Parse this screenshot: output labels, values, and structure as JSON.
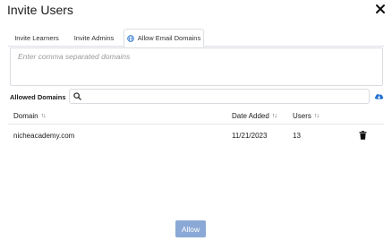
{
  "dialog": {
    "title": "Invite Users"
  },
  "tabs": [
    {
      "label": "Invite Learners"
    },
    {
      "label": "Invite Admins"
    },
    {
      "label": "Allow Email Domains"
    }
  ],
  "domain_input": {
    "placeholder": "Enter comma separated domains",
    "value": ""
  },
  "allowed": {
    "label": "Allowed Domains",
    "search_value": ""
  },
  "table": {
    "columns": [
      {
        "label": "Domain",
        "sort_icon": "↑↓"
      },
      {
        "label": "Date Added",
        "sort_icon": "↑↓"
      },
      {
        "label": "Users",
        "sort_icon": "↑↓"
      }
    ],
    "rows": [
      {
        "domain": "nicheacademy.com",
        "date_added": "11/21/2023",
        "users": "13"
      }
    ]
  },
  "actions": {
    "allow_label": "Allow"
  },
  "colors": {
    "accent": "#1f6fd1",
    "allow_button": "#8ba9d6",
    "border": "#d9dce1"
  },
  "icons": [
    "close-icon",
    "globe-icon",
    "search-icon",
    "cloud-download-icon",
    "trash-icon"
  ]
}
